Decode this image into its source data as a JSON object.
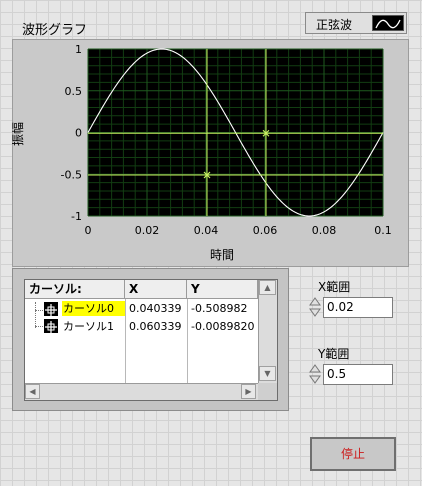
{
  "graph": {
    "title": "波形グラフ",
    "legend_label": "正弦波",
    "xlabel": "時間",
    "ylabel": "振幅",
    "x_ticks": [
      "0",
      "0.02",
      "0.04",
      "0.06",
      "0.08",
      "0.1"
    ],
    "y_ticks": [
      "1",
      "0.5",
      "0",
      "-0.5",
      "-1"
    ],
    "cursors": [
      {
        "name": "カーソル0",
        "x": 0.040339,
        "y": -0.508982
      },
      {
        "name": "カーソル1",
        "x": 0.060339,
        "y": -0.008982
      }
    ],
    "colors": {
      "plot_bg": "#000000",
      "grid": "#1f5a1f",
      "trace": "#ffffff",
      "cursor": "#c8f060"
    }
  },
  "chart_data": {
    "type": "line",
    "xlabel": "時間",
    "ylabel": "振幅",
    "xlim": [
      0,
      0.1
    ],
    "ylim": [
      -1,
      1
    ],
    "x": [
      0,
      0.005,
      0.01,
      0.015,
      0.02,
      0.025,
      0.03,
      0.035,
      0.04,
      0.045,
      0.05,
      0.055,
      0.06,
      0.065,
      0.07,
      0.075,
      0.08,
      0.085,
      0.09,
      0.095,
      0.1
    ],
    "series": [
      {
        "name": "正弦波",
        "values": [
          0,
          0.309,
          0.588,
          0.809,
          0.951,
          1,
          0.951,
          0.809,
          0.588,
          0.309,
          0,
          -0.309,
          -0.588,
          -0.809,
          -0.951,
          -1,
          -0.951,
          -0.809,
          -0.588,
          -0.309,
          0
        ]
      }
    ]
  },
  "cursor_table": {
    "headers": [
      "カーソル:",
      "X",
      "Y"
    ],
    "rows": [
      {
        "name": "カーソル0",
        "x": "0.040339",
        "y": "-0.508982"
      },
      {
        "name": "カーソル1",
        "x": "0.060339",
        "y": "-0.0089820"
      }
    ]
  },
  "controls": {
    "x_range": {
      "label": "X範囲",
      "value": "0.02"
    },
    "y_range": {
      "label": "Y範囲",
      "value": "0.5"
    },
    "stop_label": "停止"
  }
}
